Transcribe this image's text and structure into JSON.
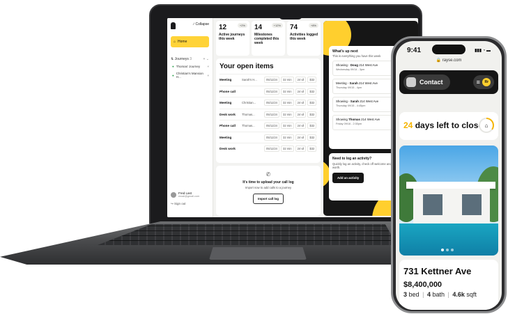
{
  "laptop": {
    "sidebar": {
      "collapse_label": "Collapse",
      "home_label": "Home",
      "journeys_label": "Journeys",
      "journeys_count": "3",
      "journeys": [
        {
          "label": "Thomas' Journey"
        },
        {
          "label": "Christian's Mansion H..."
        }
      ],
      "user_name": "Fred Last",
      "user_email": "email@gmail.com",
      "signout_label": "Sign out"
    },
    "stats": [
      {
        "value": "12",
        "badge": "+2%",
        "label": "Active journeys this week"
      },
      {
        "value": "14",
        "badge": "+12%",
        "label": "Milestones completed this week"
      },
      {
        "value": "74",
        "badge": "+8%",
        "label": "Activities logged this week"
      }
    ],
    "open_items": {
      "title": "Your open items",
      "rows": [
        {
          "type": "Meeting",
          "person": "Sarah's H...",
          "date": "05/11/24",
          "dur": "32 min",
          "count": "24 vil",
          "amount": "$32"
        },
        {
          "type": "Phone call",
          "person": "",
          "date": "05/11/24",
          "dur": "32 min",
          "count": "24 vil",
          "amount": "$32"
        },
        {
          "type": "Meeting",
          "person": "Christian...",
          "date": "05/11/24",
          "dur": "32 min",
          "count": "24 vil",
          "amount": "$32"
        },
        {
          "type": "Desk work",
          "person": "Thomas...",
          "date": "05/11/24",
          "dur": "32 min",
          "count": "24 vil",
          "amount": "$32"
        },
        {
          "type": "Phone call",
          "person": "Thomas...",
          "date": "05/11/24",
          "dur": "32 min",
          "count": "24 vil",
          "amount": "$32"
        },
        {
          "type": "Meeting",
          "person": "",
          "date": "05/11/24",
          "dur": "32 min",
          "count": "24 vil",
          "amount": "$32"
        },
        {
          "type": "Desk work",
          "person": "",
          "date": "05/11/24",
          "dur": "32 min",
          "count": "24 vil",
          "amount": "$32"
        }
      ]
    },
    "upload": {
      "title": "It's time to upload your call log",
      "subtitle": "Import now to add calls to a journey",
      "button": "Import call log"
    },
    "whats_next": {
      "title": "What's up next",
      "subtitle": "This is everything you have this week",
      "showings": [
        {
          "prefix": "Showing -",
          "name": "Doug",
          "address": "214 West Ave",
          "time": "Wednesday 09/14 - 3pm"
        },
        {
          "prefix": "Meeting -",
          "name": "Sarah",
          "address": "214 West Ave",
          "time": "Thursday 09/15 - 4pm"
        },
        {
          "prefix": "Showing -",
          "name": "Sarah",
          "address": "214 West Ave",
          "time": "Thursday 09/15 - 4:45pm"
        },
        {
          "prefix": "Showing",
          "name": "Thomas",
          "address": "214 West Ave",
          "time": "Friday 09/16 - 2:30pm"
        }
      ]
    },
    "log_activity": {
      "title": "Need to log an activity?",
      "subtitle": "Quickly log an activity, check off welcome and show your worth.",
      "button": "Add an activity"
    }
  },
  "phone": {
    "time": "9:41",
    "signal": "▮▮▮ ◔ ▬",
    "url": "rayse.com",
    "contact_label": "Contact",
    "menu_icon": "≡",
    "brand_badge": "Rr",
    "days_count": "24",
    "days_text": "days left to close",
    "progress_fraction": 0.35,
    "listing": {
      "address": "731 Kettner Ave",
      "price": "$8,400,000",
      "beds": "3",
      "beds_label": "bed",
      "baths": "4",
      "baths_label": "bath",
      "sqft": "4.6k",
      "sqft_label": "sqft"
    }
  }
}
